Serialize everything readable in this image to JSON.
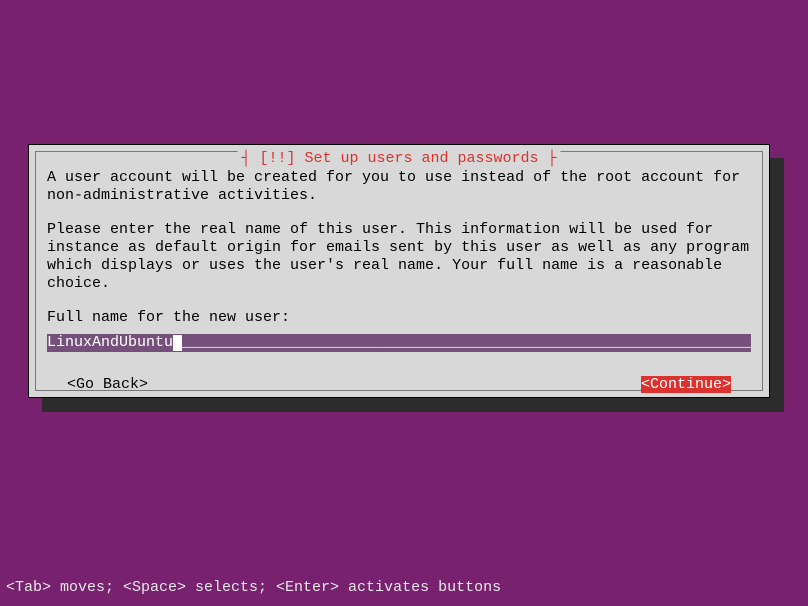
{
  "dialog": {
    "title": "[!!] Set up users and passwords",
    "paragraph1": "A user account will be created for you to use instead of the root account for non-administrative activities.",
    "paragraph2": "Please enter the real name of this user. This information will be used for instance as default origin for emails sent by this user as well as any program which displays or uses the user's real name. Your full name is a reasonable choice.",
    "prompt": "Full name for the new user:",
    "input_value": "LinuxAndUbuntu",
    "go_back": "<Go Back>",
    "continue": "<Continue>"
  },
  "status_bar": "<Tab> moves; <Space> selects; <Enter> activates buttons"
}
